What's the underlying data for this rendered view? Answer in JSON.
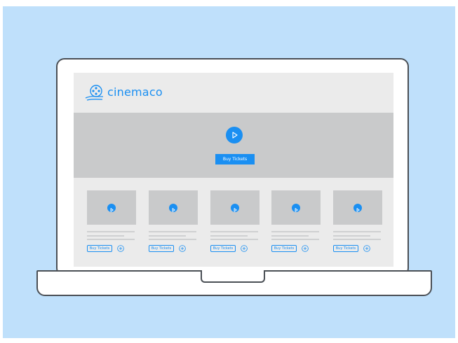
{
  "brand": {
    "name": "cinemaco",
    "logo_icon": "film-reel-icon"
  },
  "colors": {
    "accent": "#1a8ff2",
    "background": "#bfe0fb",
    "placeholder": "#c9cacb"
  },
  "hero": {
    "play_icon": "play-icon",
    "buy_label": "Buy Tickets"
  },
  "cards": [
    {
      "play_icon": "play-icon",
      "buy_label": "Buy Tickets",
      "add_icon": "plus-circle-icon"
    },
    {
      "play_icon": "play-icon",
      "buy_label": "Buy Tickets",
      "add_icon": "plus-circle-icon"
    },
    {
      "play_icon": "play-icon",
      "buy_label": "Buy Tickets",
      "add_icon": "plus-circle-icon"
    },
    {
      "play_icon": "play-icon",
      "buy_label": "Buy Tickets",
      "add_icon": "plus-circle-icon"
    },
    {
      "play_icon": "play-icon",
      "buy_label": "Buy Tickets",
      "add_icon": "plus-circle-icon"
    }
  ]
}
